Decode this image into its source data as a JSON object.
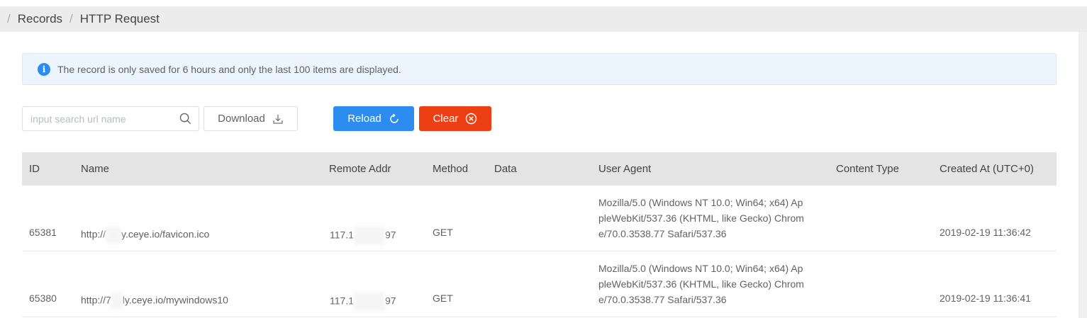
{
  "breadcrumb": {
    "separator": "/",
    "items": [
      "Records",
      "HTTP Request"
    ]
  },
  "alert": {
    "icon": "info-icon",
    "text": "The record is only saved for 6 hours and only the last 100 items are displayed."
  },
  "toolbar": {
    "search_placeholder": "input search url name",
    "download_label": "Download",
    "reload_label": "Reload",
    "clear_label": "Clear"
  },
  "colors": {
    "primary": "#2d8cf0",
    "danger": "#ed3f14",
    "alert_bg": "#ecf5fd",
    "header_bg": "#e4e4e4"
  },
  "table": {
    "columns": [
      "ID",
      "Name",
      "Remote Addr",
      "Method",
      "Data",
      "User Agent",
      "Content Type",
      "Created At (UTC+0)"
    ],
    "rows": [
      {
        "id": "65381",
        "name_prefix": "http://",
        "name_suffix": "y.ceye.io/favicon.ico",
        "addr_prefix": "117.1",
        "addr_suffix": "97",
        "method": "GET",
        "data": "",
        "ua_lines": [
          "Mozilla/5.0 (Windows NT 10.0; Win64; x64) Ap",
          "pleWebKit/537.36 (KHTML, like Gecko) Chrom",
          "e/70.0.3538.77 Safari/537.36"
        ],
        "content_type": "",
        "created_at": "2019-02-19 11:36:42"
      },
      {
        "id": "65380",
        "name_prefix": "http://7",
        "name_suffix": "ly.ceye.io/mywindows10",
        "addr_prefix": "117.1",
        "addr_suffix": "97",
        "method": "GET",
        "data": "",
        "ua_lines": [
          "Mozilla/5.0 (Windows NT 10.0; Win64; x64) Ap",
          "pleWebKit/537.36 (KHTML, like Gecko) Chrom",
          "e/70.0.3538.77 Safari/537.36"
        ],
        "content_type": "",
        "created_at": "2019-02-19 11:36:41"
      }
    ]
  }
}
